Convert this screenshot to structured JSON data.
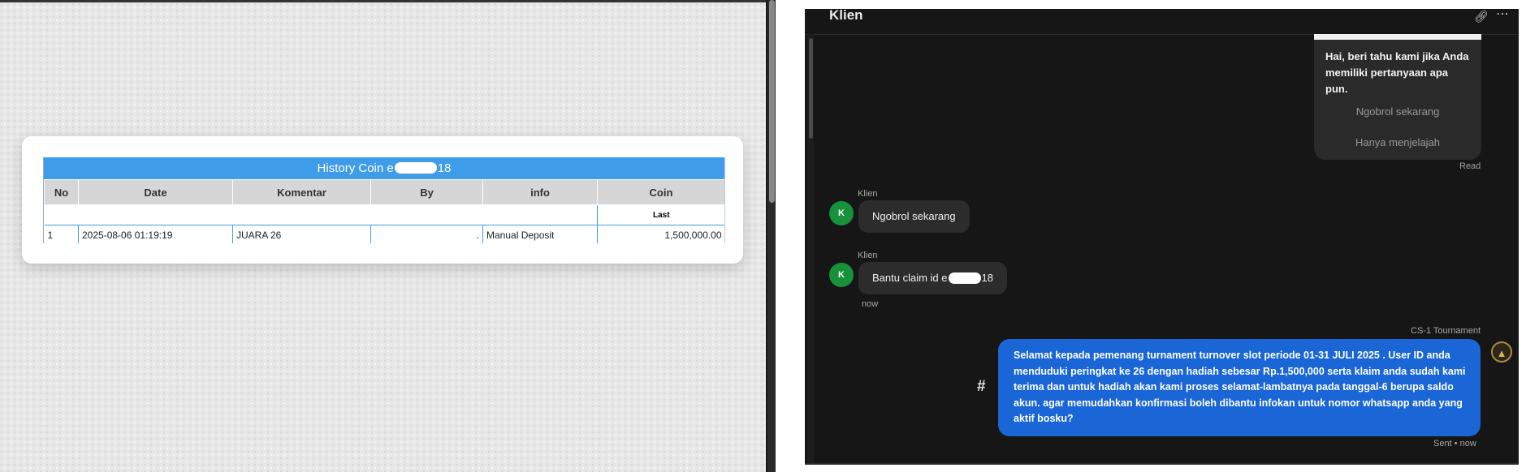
{
  "history": {
    "title_prefix": "History Coin e",
    "title_suffix": "18",
    "columns": [
      "No",
      "Date",
      "Komentar",
      "By",
      "info",
      "Coin"
    ],
    "sub_header": "Last",
    "rows": [
      {
        "no": "1",
        "date": "2025-08-06 01:19:19",
        "komentar": "JUARA 26",
        "by": ".",
        "info": "Manual Deposit",
        "coin": "1,500,000.00"
      }
    ]
  },
  "chat": {
    "title": "Klien",
    "welcome_text": "Hai, beri tahu kami jika Anda memiliki pertanyaan apa pun.",
    "options": [
      "Ngobrol sekarang",
      "Hanya menjelajah"
    ],
    "read_status": "Read",
    "messages": [
      {
        "sender": "Klien",
        "avatar": "K",
        "text": "Ngobrol sekarang"
      },
      {
        "sender": "Klien",
        "avatar": "K",
        "text_prefix": "Bantu claim id e",
        "text_suffix": "18",
        "time": "now"
      }
    ],
    "agent": {
      "name": "CS-1 Tournament",
      "text": "Selamat kepada pemenang turnament turnover slot periode 01-31 JULI 2025 . User ID anda menduduki peringkat ke 26 dengan hadiah sebesar Rp.1,500,000 serta klaim anda sudah kami terima dan untuk hadiah akan kami proses selamat-lambatnya pada tanggal-6 berupa saldo akun. agar memudahkan konfirmasi boleh dibantu infokan untuk nomor whatsapp anda yang aktif bosku?",
      "status": "Sent • now",
      "hash": "#"
    },
    "icons": [
      "link-icon",
      "more-icon",
      "hash-icon",
      "agent-avatar-icon"
    ]
  }
}
